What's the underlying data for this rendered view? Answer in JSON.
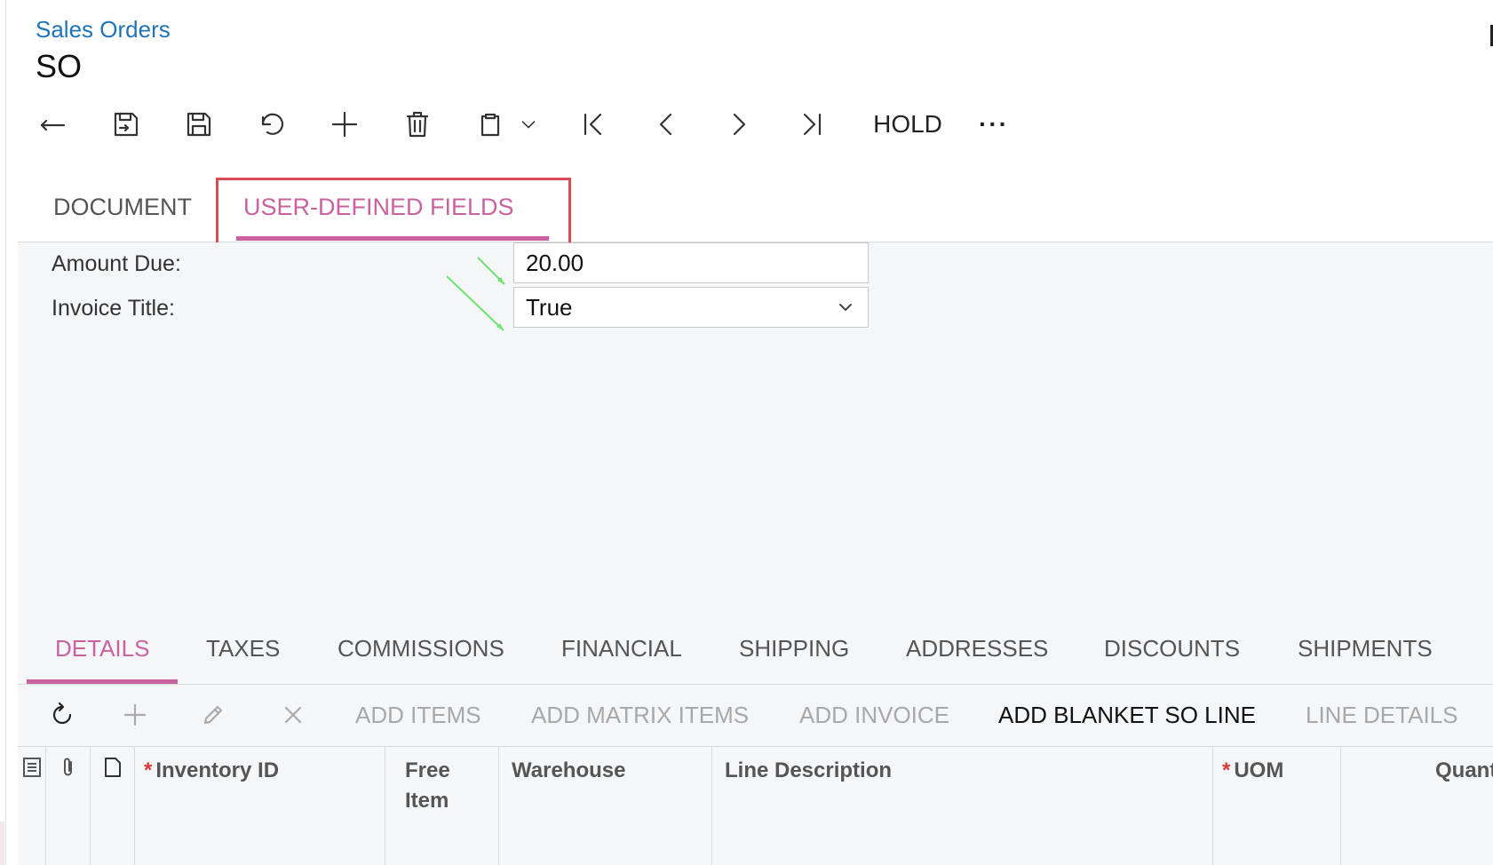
{
  "breadcrumb": "Sales Orders",
  "page_title": "SO",
  "toolbar": {
    "back_icon": "back-arrow-icon",
    "save_close_icon": "save-and-close-icon",
    "save_icon": "save-icon",
    "undo_icon": "undo-icon",
    "add_icon": "plus-icon",
    "delete_icon": "trash-icon",
    "copy_icon": "clipboard-icon",
    "hold_label": "HOLD",
    "more_label": "···"
  },
  "tabs": [
    {
      "label": "DOCUMENT",
      "active": false
    },
    {
      "label": "USER-DEFINED FIELDS",
      "active": true
    }
  ],
  "form": {
    "amount_due_label": "Amount Due:",
    "amount_due_value": "20.00",
    "invoice_title_label": "Invoice Title:",
    "invoice_title_value": "True"
  },
  "bottom_tabs": [
    {
      "label": "DETAILS",
      "active": true
    },
    {
      "label": "TAXES"
    },
    {
      "label": "COMMISSIONS"
    },
    {
      "label": "FINANCIAL"
    },
    {
      "label": "SHIPPING"
    },
    {
      "label": "ADDRESSES"
    },
    {
      "label": "DISCOUNTS"
    },
    {
      "label": "SHIPMENTS"
    }
  ],
  "grid_toolbar": {
    "add_items": "ADD ITEMS",
    "add_matrix_items": "ADD MATRIX ITEMS",
    "add_invoice": "ADD INVOICE",
    "add_blanket_so_line": "ADD BLANKET SO LINE",
    "line_details": "LINE DETAILS"
  },
  "grid_columns": {
    "inventory_id": "Inventory ID",
    "free_item_1": "Free",
    "free_item_2": "Item",
    "warehouse": "Warehouse",
    "line_description": "Line Description",
    "uom": "UOM",
    "quantity": "Quantity"
  },
  "colors": {
    "accent": "#c9629e",
    "link": "#1f74b7",
    "highlight": "#d94b55",
    "annotation_arrow": "#6fe36f",
    "required": "#d93a3a"
  }
}
